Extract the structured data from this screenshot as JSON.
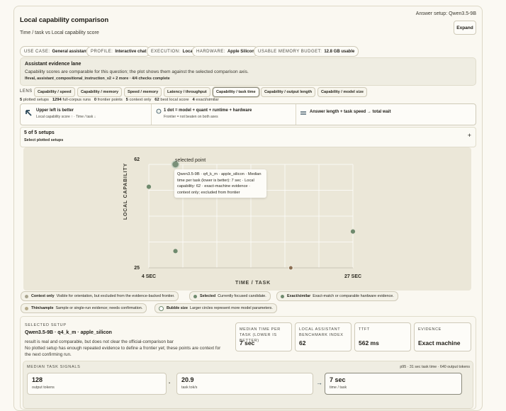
{
  "header": {
    "title": "Local capability comparison",
    "subtitle": "Time / task vs Local capability score",
    "answer_setup": "Answer setup: Qwen3.5-9B",
    "expand_label": "Expand"
  },
  "context_pills": [
    {
      "key": "USE CASE:",
      "value": "General assistant"
    },
    {
      "key": "PROFILE:",
      "value": "Interactive chat"
    },
    {
      "key": "EXECUTION:",
      "value": "Local"
    },
    {
      "key": "HARDWARE:",
      "value": "Apple Silicon"
    },
    {
      "key": "USABLE MEMORY BUDGET:",
      "value": "12.8 GB usable"
    }
  ],
  "evidence_lane": {
    "title": "Assistant evidence lane",
    "body": "Capability scores are comparable for this question; the plot shows them against the selected comparison axis.",
    "detail": "Ifeval, assistant_compositional_instruction_v2 + 2 more · 4/4 checks complete"
  },
  "lens": {
    "label": "LENS",
    "tabs": [
      "Capability / speed",
      "Capability / memory",
      "Speed / memory",
      "Latency / throughput",
      "Capability / task time",
      "Capability / output length",
      "Capability / model size"
    ],
    "active_index": 4
  },
  "stats": [
    {
      "num": "5",
      "text": "plotted setups"
    },
    {
      "num": "1294",
      "text": "full-corpus runs"
    },
    {
      "num": "0",
      "text": "frontier points"
    },
    {
      "num": "5",
      "text": "context only"
    },
    {
      "num": "62",
      "text": "best local score"
    },
    {
      "num": "4",
      "text": "exact/similar"
    }
  ],
  "guides": [
    {
      "main": "Upper left is better",
      "sub": "Local capability score ↑ · Time / task ↓"
    },
    {
      "main": "1 dot = model + quant + runtime + hardware",
      "sub": "Frontier = not beaten on both axes"
    },
    {
      "main": "Answer length + task speed → total wait",
      "sub": ""
    }
  ],
  "setups": {
    "count_label": "5 of 5 setups",
    "select_label": "Select plotted setups",
    "toggle": "+"
  },
  "chart_data": {
    "type": "scatter",
    "ylabel": "LOCAL CAPABILITY",
    "xlabel": "TIME / TASK",
    "x_ticks": [
      "4 SEC",
      "27 SEC"
    ],
    "y_ticks": [
      "62",
      "25"
    ],
    "xlim": [
      4,
      27
    ],
    "ylim": [
      25,
      62
    ],
    "points": [
      {
        "x": 7,
        "y": 62,
        "selected": true
      },
      {
        "x": 4,
        "y": 54
      },
      {
        "x": 7,
        "y": 31
      },
      {
        "x": 27,
        "y": 38
      },
      {
        "x": 20,
        "y": 25
      }
    ],
    "selected_label": "selected point",
    "tooltip": "Qwen3.5-9B · q4_k_m · apple_silicon · Median time per task (lower is better): 7 sec · Local capability: 62 · exact-machine evidence · context only; excluded from frontier"
  },
  "legend": [
    {
      "label": "Context only",
      "desc": "Visible for orientation, but excluded from the evidence-backed frontier.",
      "color": "#a9a48f"
    },
    {
      "label": "Selected",
      "desc": "Currently focused candidate.",
      "color": "#6f8a6e"
    },
    {
      "label": "Exact/similar",
      "desc": "Exact-match or comparable hardware evidence.",
      "color": "#6f8a6e"
    },
    {
      "label": "Thin/sample",
      "desc": "Sample or single-run evidence; needs confirmation.",
      "color": "#b6ab8c"
    },
    {
      "label": "Bubble size",
      "desc": "Larger circles represent more model parameters.",
      "color": "#ffffff"
    }
  ],
  "selected_setup": {
    "label": "SELECTED SETUP",
    "name": "Qwen3.5-9B · q4_k_m · apple_silicon",
    "line1": "result is real and comparable, but does not clear the official-comparison bar",
    "line2": "No plotted setup has enough repeated evidence to define a frontier yet; these points are context for",
    "line3": "the next confirming run.",
    "metrics": [
      {
        "key": "MEDIAN TIME PER TASK (LOWER IS BETTER)",
        "value": "7 sec"
      },
      {
        "key": "LOCAL ASSISTANT BENCHMARK INDEX",
        "value": "62"
      },
      {
        "key": "TTFT",
        "value": "562 ms"
      },
      {
        "key": "EVIDENCE",
        "value": "Exact machine"
      }
    ]
  },
  "signals": {
    "label": "MEDIAN TASK SIGNALS",
    "right_note": "p95 · 31 sec task time · 640 output tokens",
    "cards": [
      {
        "value": "128",
        "label": "output tokens"
      },
      {
        "value": "20.9",
        "label": "task tok/s"
      },
      {
        "value": "7 sec",
        "label": "time / task"
      }
    ],
    "sep_dot": "·",
    "arrow": "→"
  }
}
